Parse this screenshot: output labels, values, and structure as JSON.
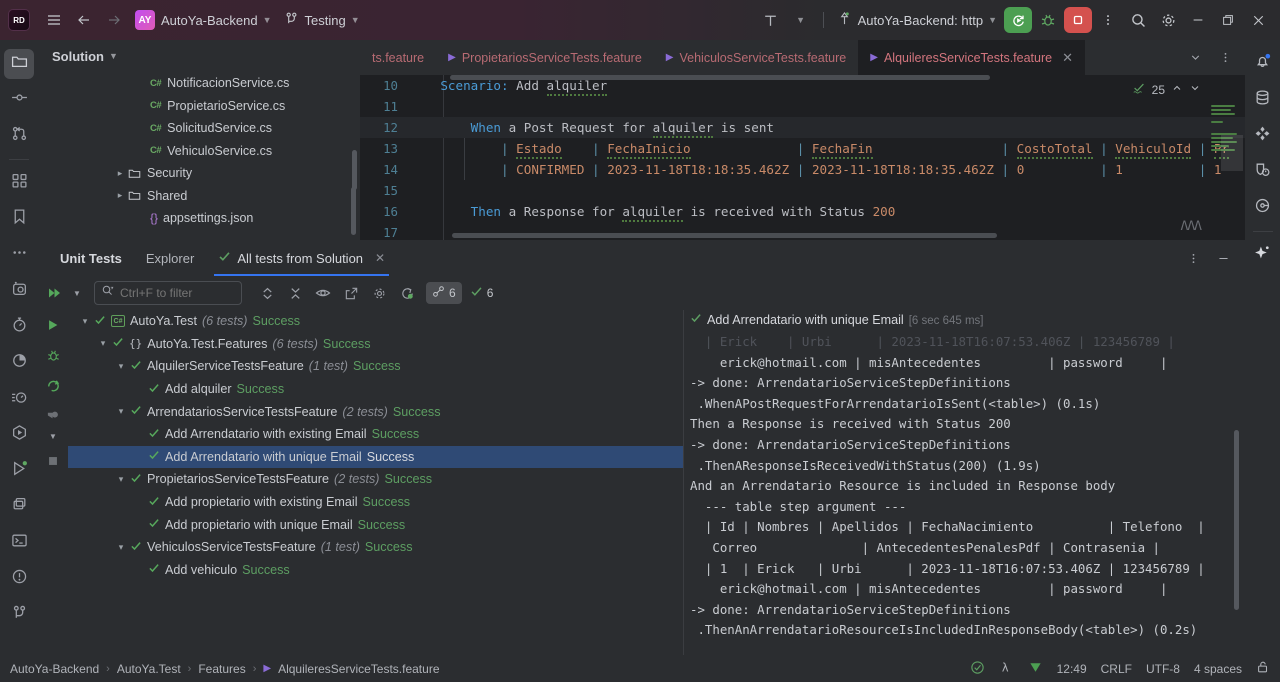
{
  "titlebar": {
    "logo": "RD",
    "menu_icon": "hamburger-icon",
    "back_icon": "arrow-left-icon",
    "forward_icon": "arrow-right-icon",
    "project_initials": "AY",
    "project_name": "AutoYa-Backend",
    "branch_icon": "vcs-branch-icon",
    "branch_name": "Testing",
    "updates_icon": "updates-icon",
    "run_config_icon": "run-config-icon",
    "run_config": "AutoYa-Backend: http",
    "run_icon": "run-rerun-icon",
    "debug_icon": "debug-bug-icon",
    "stop_icon": "stop-icon",
    "more_icon": "more-vertical-icon",
    "search_icon": "search-icon",
    "settings_icon": "gear-icon",
    "minimize_icon": "minimize-icon",
    "maximize_icon": "maximize-icon",
    "close_icon": "close-icon"
  },
  "left_rail": {
    "items": [
      {
        "name": "solution-explorer",
        "icon": "folder-icon",
        "active": true
      },
      {
        "name": "commit",
        "icon": "commit-node-icon",
        "active": false
      },
      {
        "name": "pull-requests",
        "icon": "branch-merge-icon",
        "active": false
      },
      {
        "name": "nuget",
        "icon": "packages-icon",
        "active": false
      },
      {
        "name": "bookmarks",
        "icon": "bookmark-icon",
        "active": false
      },
      {
        "name": "more-tool-windows",
        "icon": "ellipsis-icon",
        "active": false
      },
      {
        "name": "database-tool",
        "icon": "camera-db-icon",
        "active": false
      },
      {
        "name": "profiler",
        "icon": "stopwatch-icon",
        "active": false
      },
      {
        "name": "coverage",
        "icon": "pie-chart-icon",
        "active": false
      },
      {
        "name": "dynamic-program-analysis",
        "icon": "timer-lines-icon",
        "active": false
      },
      {
        "name": "unit-tests-explorer",
        "icon": "play-hexagon-icon",
        "active": false
      },
      {
        "name": "unit-tests",
        "icon": "play-triangle-icon",
        "active": false
      },
      {
        "name": "services",
        "icon": "services-stack-icon",
        "active": false
      },
      {
        "name": "terminal",
        "icon": "terminal-icon",
        "active": false
      },
      {
        "name": "problems",
        "icon": "warning-circle-icon",
        "active": false
      },
      {
        "name": "version-control",
        "icon": "git-branch-icon",
        "active": false
      }
    ]
  },
  "right_rail": {
    "items": [
      {
        "name": "notifications",
        "icon": "bell-icon",
        "badge": true
      },
      {
        "name": "database",
        "icon": "database-icon",
        "badge": false
      },
      {
        "name": "plugins",
        "icon": "plugins-diamond-icon",
        "badge": false
      },
      {
        "name": "endpoints",
        "icon": "shield-clock-icon",
        "badge": false
      },
      {
        "name": "history",
        "icon": "history-circle-icon",
        "badge": false
      },
      {
        "name": "ai-assistant",
        "icon": "sparkle-icon",
        "badge": false
      }
    ]
  },
  "solution": {
    "header": "Solution",
    "header_chevron": "chevron-down-icon",
    "tree": [
      {
        "label": "NotificacionService.cs",
        "icon": "csharp-file-icon",
        "indent": 4,
        "arrow": ""
      },
      {
        "label": "PropietarioService.cs",
        "icon": "csharp-file-icon",
        "indent": 4,
        "arrow": ""
      },
      {
        "label": "SolicitudService.cs",
        "icon": "csharp-file-icon",
        "indent": 4,
        "arrow": ""
      },
      {
        "label": "VehiculoService.cs",
        "icon": "csharp-file-icon",
        "indent": 4,
        "arrow": ""
      },
      {
        "label": "Security",
        "icon": "folder-icon",
        "indent": 3,
        "arrow": "chevron-right-icon"
      },
      {
        "label": "Shared",
        "icon": "folder-icon",
        "indent": 3,
        "arrow": "chevron-right-icon"
      },
      {
        "label": "appsettings.json",
        "icon": "json-file-icon",
        "indent": 4,
        "arrow": ""
      }
    ]
  },
  "editor_tabs": {
    "tabs": [
      {
        "label": "ts.feature",
        "icon": "feature-file-icon",
        "active": false,
        "truncated": true
      },
      {
        "label": "PropietariosServiceTests.feature",
        "icon": "feature-file-icon",
        "active": false
      },
      {
        "label": "VehiculosServiceTests.feature",
        "icon": "feature-file-icon",
        "active": false
      },
      {
        "label": "AlquileresServiceTests.feature",
        "icon": "feature-file-icon",
        "active": true,
        "close_icon": "close-icon"
      }
    ],
    "chevron_icon": "chevron-down-icon",
    "more_icon": "more-vertical-icon"
  },
  "editor": {
    "inspection_count": "25",
    "inspection_icon": "inspection-check-icon",
    "up_icon": "chevron-up-icon",
    "down_icon": "chevron-down-icon",
    "lines": [
      {
        "num": "10",
        "indent": 4,
        "segments": [
          {
            "t": "Scenario:",
            "c": "kw"
          },
          {
            "t": " Add ",
            "c": ""
          },
          {
            "t": "alquiler",
            "c": "wavy"
          }
        ]
      },
      {
        "num": "11",
        "indent": 0,
        "segments": []
      },
      {
        "num": "12",
        "indent": 8,
        "current": true,
        "segments": [
          {
            "t": "When",
            "c": "kw"
          },
          {
            "t": " a Post Request for ",
            "c": ""
          },
          {
            "t": "alquiler",
            "c": "wavy"
          },
          {
            "t": " is sent",
            "c": ""
          }
        ]
      },
      {
        "num": "13",
        "indent": 12,
        "segments": [
          {
            "t": "| ",
            "c": "tbl"
          },
          {
            "t": "Estado",
            "c": "str wavy"
          },
          {
            "t": "    ",
            "c": ""
          },
          {
            "t": "| ",
            "c": "tbl"
          },
          {
            "t": "FechaInicio",
            "c": "str wavy"
          },
          {
            "t": "              ",
            "c": ""
          },
          {
            "t": "| ",
            "c": "tbl"
          },
          {
            "t": "FechaFin",
            "c": "str wavy"
          },
          {
            "t": "                 ",
            "c": ""
          },
          {
            "t": "| ",
            "c": "tbl"
          },
          {
            "t": "CostoTotal",
            "c": "str wavy"
          },
          {
            "t": " ",
            "c": ""
          },
          {
            "t": "| ",
            "c": "tbl"
          },
          {
            "t": "VehiculoId",
            "c": "str wavy"
          },
          {
            "t": " ",
            "c": ""
          },
          {
            "t": "| ",
            "c": "tbl"
          },
          {
            "t": "Pr",
            "c": "str wavy"
          }
        ]
      },
      {
        "num": "14",
        "indent": 12,
        "segments": [
          {
            "t": "| ",
            "c": "tbl"
          },
          {
            "t": "CONFIRMED",
            "c": "str"
          },
          {
            "t": " ",
            "c": ""
          },
          {
            "t": "| ",
            "c": "tbl"
          },
          {
            "t": "2023-11-18T18:18:35.462Z",
            "c": "str"
          },
          {
            "t": " ",
            "c": ""
          },
          {
            "t": "| ",
            "c": "tbl"
          },
          {
            "t": "2023-11-18T18:18:35.462Z",
            "c": "str"
          },
          {
            "t": " ",
            "c": ""
          },
          {
            "t": "| ",
            "c": "tbl"
          },
          {
            "t": "0",
            "c": "str"
          },
          {
            "t": "          ",
            "c": ""
          },
          {
            "t": "| ",
            "c": "tbl"
          },
          {
            "t": "1",
            "c": "str"
          },
          {
            "t": "          ",
            "c": ""
          },
          {
            "t": "| ",
            "c": "tbl"
          },
          {
            "t": "1",
            "c": "str"
          }
        ]
      },
      {
        "num": "15",
        "indent": 0,
        "segments": []
      },
      {
        "num": "16",
        "indent": 8,
        "segments": [
          {
            "t": "Then",
            "c": "kw"
          },
          {
            "t": " a Response for ",
            "c": ""
          },
          {
            "t": "alquiler",
            "c": "wavy"
          },
          {
            "t": " is received with Status ",
            "c": ""
          },
          {
            "t": "200",
            "c": "num"
          }
        ]
      },
      {
        "num": "17",
        "indent": 0,
        "segments": []
      }
    ]
  },
  "unit_tests": {
    "tabs": [
      {
        "label": "Unit Tests",
        "selected": false,
        "bold": true
      },
      {
        "label": "Explorer",
        "selected": false,
        "bold": false
      },
      {
        "label": "All tests from Solution",
        "selected": true,
        "bold": false,
        "icon": "check-green-icon",
        "close_icon": "close-icon"
      }
    ],
    "panel_more_icon": "more-vertical-icon",
    "panel_minimize_icon": "minimize-icon",
    "toolbar": {
      "rerun_icon": "rerun-all-icon",
      "rerun_caret": "chevron-down-icon",
      "filter_placeholder": "Ctrl+F to filter",
      "filter_value": "",
      "search_icon": "search-icon",
      "expand_collapse_icon": "sort-updown-icon",
      "collapse_icon": "collapse-all-icon",
      "preview_icon": "eye-icon",
      "export_icon": "export-icon",
      "settings_icon": "gear-icon",
      "rerun_failed_icon": "rerun-failed-icon",
      "duration_icon": "duration-icon",
      "duration_count": "6",
      "passed_icon": "check-icon",
      "passed_count": "6"
    },
    "side_icons": [
      {
        "name": "run-tests",
        "icon": "play-icon"
      },
      {
        "name": "debug-tests",
        "icon": "debug-bug-icon"
      },
      {
        "name": "rerun-tests",
        "icon": "refresh-icon"
      },
      {
        "name": "run-with-coverage",
        "icon": "coverage-icon"
      },
      {
        "name": "stop-tests",
        "icon": "stop-square-icon"
      }
    ],
    "tree": [
      {
        "indent": 0,
        "arrow": "chevron-down-icon",
        "check": true,
        "badge": "cs",
        "label": "AutoYa.Test",
        "count": "(6 tests)",
        "status": "Success",
        "dim": false,
        "selected": false
      },
      {
        "indent": 1,
        "arrow": "chevron-down-icon",
        "check": true,
        "badge": "ns",
        "label": "AutoYa.Test.Features",
        "count": "(6 tests)",
        "status": "Success",
        "dim": false,
        "selected": false
      },
      {
        "indent": 2,
        "arrow": "chevron-down-icon",
        "check": true,
        "badge": "",
        "label": "AlquilerServiceTestsFeature",
        "count": "(1 test)",
        "status": "Success",
        "dim": false,
        "selected": false
      },
      {
        "indent": 3,
        "arrow": "",
        "check": true,
        "badge": "",
        "label": "Add alquiler",
        "count": "",
        "status": "Success",
        "dim": false,
        "selected": false
      },
      {
        "indent": 2,
        "arrow": "chevron-down-icon",
        "check": true,
        "badge": "",
        "label": "ArrendatariosServiceTestsFeature",
        "count": "(2 tests)",
        "status": "Success",
        "dim": false,
        "selected": false
      },
      {
        "indent": 3,
        "arrow": "",
        "check": true,
        "badge": "",
        "label": "Add Arrendatario with existing Email",
        "count": "",
        "status": "Success",
        "dim": false,
        "selected": false
      },
      {
        "indent": 3,
        "arrow": "",
        "check": true,
        "badge": "",
        "label": "Add Arrendatario with unique Email",
        "count": "",
        "status": "Success",
        "dim": false,
        "selected": true
      },
      {
        "indent": 2,
        "arrow": "chevron-down-icon",
        "check": true,
        "badge": "",
        "label": "PropietariosServiceTestsFeature",
        "count": "(2 tests)",
        "status": "Success",
        "dim": false,
        "selected": false
      },
      {
        "indent": 3,
        "arrow": "",
        "check": true,
        "badge": "",
        "label": "Add propietario with existing Email",
        "count": "",
        "status": "Success",
        "dim": false,
        "selected": false
      },
      {
        "indent": 3,
        "arrow": "",
        "check": true,
        "badge": "",
        "label": "Add propietario with unique Email",
        "count": "",
        "status": "Success",
        "dim": false,
        "selected": false
      },
      {
        "indent": 2,
        "arrow": "chevron-down-icon",
        "check": true,
        "badge": "",
        "label": "VehiculosServiceTestsFeature",
        "count": "(1 test)",
        "status": "Success",
        "dim": false,
        "selected": false
      },
      {
        "indent": 3,
        "arrow": "",
        "check": true,
        "badge": "",
        "label": "Add vehiculo",
        "count": "",
        "status": "Success",
        "dim": false,
        "selected": false
      }
    ],
    "output": {
      "title": "Add Arrendatario with unique Email",
      "title_icon": "check-green-icon",
      "duration": "[6 sec 645 ms]",
      "lines": [
        {
          "text": "  | Erick    | Urbi      | 2023-11-18T16:07:53.406Z | 123456789 |",
          "faint": true
        },
        {
          "text": "    erick@hotmail.com | misAntecedentes         | password     |",
          "faint": false
        },
        {
          "text": "-> done: ArrendatarioServiceStepDefinitions",
          "faint": false
        },
        {
          "text": " .WhenAPostRequestForArrendatarioIsSent(<table>) (0.1s)",
          "faint": false
        },
        {
          "text": "Then a Response is received with Status 200",
          "faint": false
        },
        {
          "text": "-> done: ArrendatarioServiceStepDefinitions",
          "faint": false
        },
        {
          "text": " .ThenAResponseIsReceivedWithStatus(200) (1.9s)",
          "faint": false
        },
        {
          "text": "And an Arrendatario Resource is included in Response body",
          "faint": false
        },
        {
          "text": "  --- table step argument ---",
          "faint": false
        },
        {
          "text": "  | Id | Nombres | Apellidos | FechaNacimiento          | Telefono  |",
          "faint": false
        },
        {
          "text": "   Correo              | AntecedentesPenalesPdf | Contrasenia |",
          "faint": false
        },
        {
          "text": "  | 1  | Erick   | Urbi      | 2023-11-18T16:07:53.406Z | 123456789 |",
          "faint": false
        },
        {
          "text": "    erick@hotmail.com | misAntecedentes         | password     |",
          "faint": false
        },
        {
          "text": "-> done: ArrendatarioServiceStepDefinitions",
          "faint": false
        },
        {
          "text": " .ThenAnArrendatarioResourceIsIncludedInResponseBody(<table>) (0.2s)",
          "faint": false
        }
      ]
    }
  },
  "statusbar": {
    "breadcrumb": [
      "AutoYa-Backend",
      "AutoYa.Test",
      "Features",
      "AlquileresServiceTests.feature"
    ],
    "breadcrumb_file_icon": "feature-file-icon",
    "inspection_icon": "inspection-ok-icon",
    "plugin_icon": "nuget-icon",
    "download_icon": "download-green-icon",
    "position": "12:49",
    "line_sep": "CRLF",
    "encoding": "UTF-8",
    "indent": "4 spaces",
    "lock_icon": "unlock-icon"
  }
}
